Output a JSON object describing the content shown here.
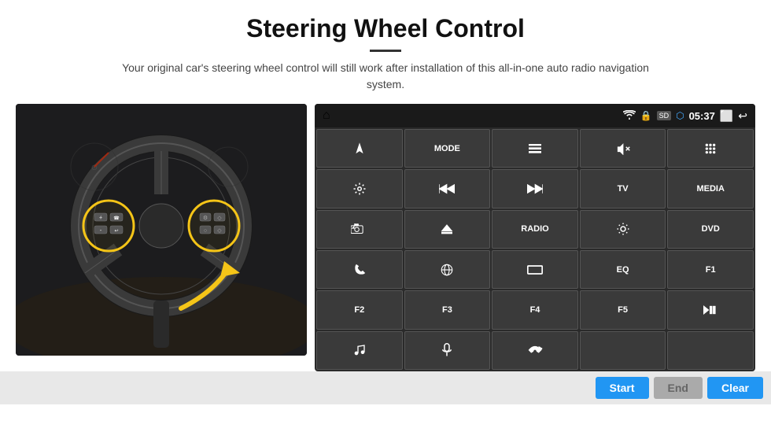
{
  "header": {
    "title": "Steering Wheel Control",
    "subtitle": "Your original car's steering wheel control will still work after installation of this all-in-one auto radio navigation system."
  },
  "statusBar": {
    "homeIcon": "⌂",
    "wifiIcon": "wifi",
    "lockIcon": "lock",
    "sdIcon": "sd",
    "btIcon": "bt",
    "time": "05:37",
    "screenIcon": "screen",
    "backIcon": "back"
  },
  "buttons": [
    {
      "label": "nav",
      "type": "icon",
      "icon": "arrow-up-right"
    },
    {
      "label": "MODE",
      "type": "text"
    },
    {
      "label": "menu",
      "type": "icon",
      "icon": "list"
    },
    {
      "label": "mute",
      "type": "icon",
      "icon": "volume-x"
    },
    {
      "label": "apps",
      "type": "icon",
      "icon": "dots"
    },
    {
      "label": "settings",
      "type": "icon",
      "icon": "gear"
    },
    {
      "label": "prev",
      "type": "icon",
      "icon": "skip-back"
    },
    {
      "label": "next",
      "type": "icon",
      "icon": "skip-forward"
    },
    {
      "label": "TV",
      "type": "text"
    },
    {
      "label": "MEDIA",
      "type": "text"
    },
    {
      "label": "camera",
      "type": "icon",
      "icon": "camera360"
    },
    {
      "label": "eject",
      "type": "icon",
      "icon": "eject"
    },
    {
      "label": "RADIO",
      "type": "text"
    },
    {
      "label": "brightness",
      "type": "icon",
      "icon": "sun"
    },
    {
      "label": "DVD",
      "type": "text"
    },
    {
      "label": "phone",
      "type": "icon",
      "icon": "phone"
    },
    {
      "label": "browse",
      "type": "icon",
      "icon": "compass"
    },
    {
      "label": "screen-off",
      "type": "icon",
      "icon": "rectangle"
    },
    {
      "label": "EQ",
      "type": "text"
    },
    {
      "label": "F1",
      "type": "text"
    },
    {
      "label": "F2",
      "type": "text"
    },
    {
      "label": "F3",
      "type": "text"
    },
    {
      "label": "F4",
      "type": "text"
    },
    {
      "label": "F5",
      "type": "text"
    },
    {
      "label": "play-pause",
      "type": "icon",
      "icon": "play-pause"
    },
    {
      "label": "music",
      "type": "icon",
      "icon": "music"
    },
    {
      "label": "mic",
      "type": "icon",
      "icon": "mic"
    },
    {
      "label": "call-end",
      "type": "icon",
      "icon": "phone-end"
    },
    {
      "label": "",
      "type": "empty"
    },
    {
      "label": "",
      "type": "empty"
    }
  ],
  "bottomButtons": {
    "start": "Start",
    "end": "End",
    "clear": "Clear"
  }
}
